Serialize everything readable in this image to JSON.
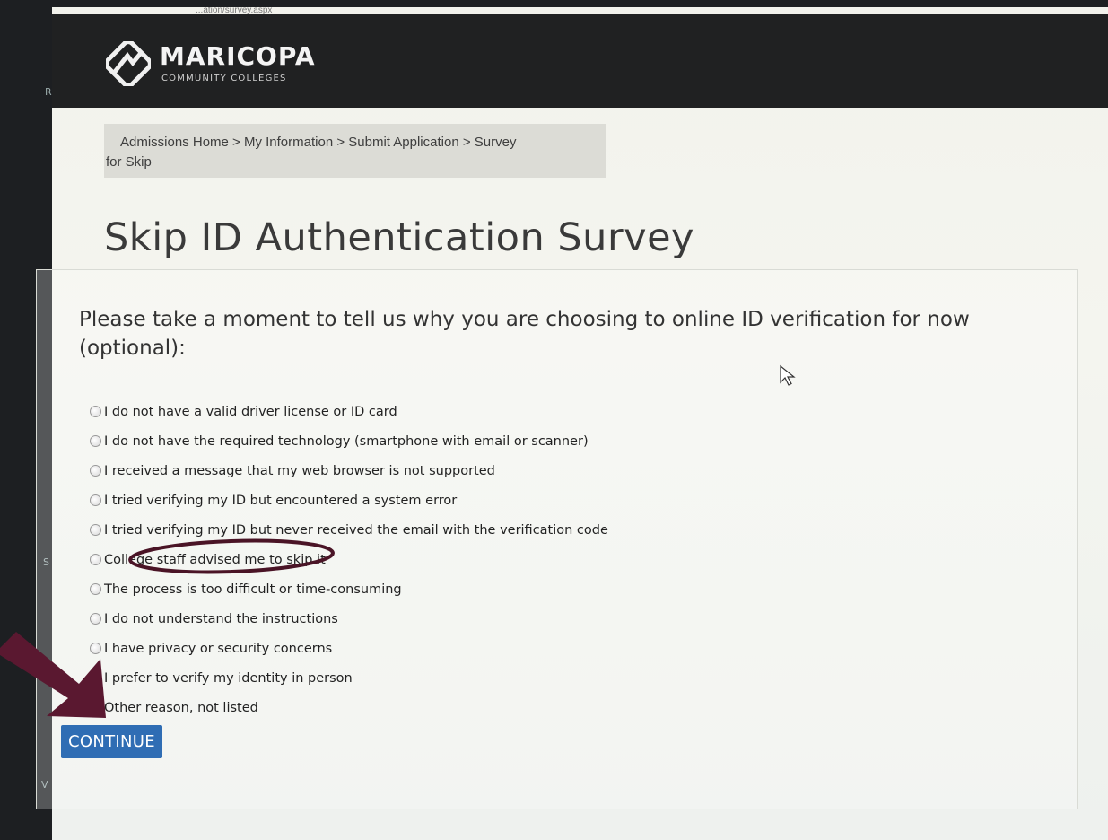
{
  "browser": {
    "url_fragment": "...ation/survey.aspx"
  },
  "header": {
    "brand_name": "MARICOPA",
    "brand_sub": "COMMUNITY COLLEGES",
    "logo_icon": "maricopa-logo-icon"
  },
  "breadcrumb": {
    "line1": "Admissions Home > My Information > Submit Application > Survey",
    "line2": "for Skip"
  },
  "page": {
    "title": "Skip ID Authentication Survey",
    "prompt": "Please take a moment to tell us why you are choosing to online ID verification for now (optional):"
  },
  "survey": {
    "options": [
      "I do not have a valid driver license or ID card",
      "I do not have the required technology (smartphone with email or scanner)",
      "I received a message that my web browser is not supported",
      "I tried verifying my ID but encountered a system error",
      "I tried verifying my ID but never received the email with the verification code",
      "College staff advised me to skip it",
      "The process is too difficult or time-consuming",
      "I do not understand the instructions",
      "I have privacy or security concerns",
      "I prefer to verify my identity in person",
      "Other reason, not listed"
    ],
    "continue_label": "CONTINUE"
  },
  "edge_chars": {
    "a": "R",
    "b": "S",
    "c": "V"
  },
  "colors": {
    "header_bg": "#202122",
    "button_bg": "#2f6db4",
    "annotation": "#5a1830"
  }
}
